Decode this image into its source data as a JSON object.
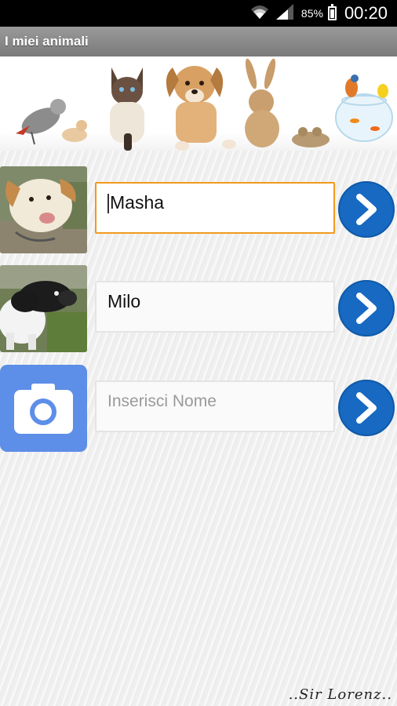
{
  "status_bar": {
    "battery": "85%",
    "time": "00:20"
  },
  "app_bar": {
    "title": "I miei animali"
  },
  "pets": [
    {
      "name": "Masha",
      "focused": true
    },
    {
      "name": "Milo",
      "focused": false
    }
  ],
  "new_pet": {
    "placeholder": "Inserisci Nome"
  },
  "signature": "..Sir Lorenz..",
  "colors": {
    "accent_blue": "#1769c2",
    "focus_orange": "#f19a1e",
    "camera_blue": "#5d8ee8"
  }
}
